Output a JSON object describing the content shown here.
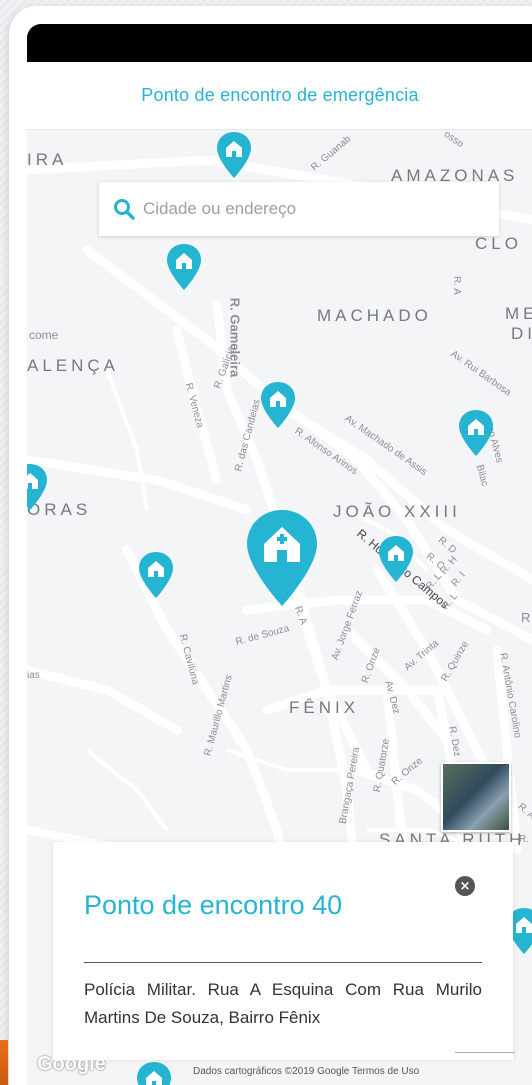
{
  "header": {
    "title": "Ponto de encontro de emergência"
  },
  "search": {
    "placeholder": "Cidade ou endereço",
    "icon": "search-icon"
  },
  "map": {
    "districts": [
      "IRA",
      "AMAZONAS",
      "CLO",
      "MACHADO",
      "ME",
      "DI",
      "ALENÇA",
      "ORAS",
      "JOÃO XXIII",
      "FÊNIX",
      "SANTA RUTH"
    ],
    "streets": [
      "R. Guanab",
      "osso",
      "R. A",
      "come",
      "Av. Rui Barbosa",
      "R. Gameleira",
      "R. Galícia",
      "R. Veneza",
      "R. das Candeias",
      "Av. Machado de Assis",
      "R. Afonso Arinos",
      "ro Alves",
      "Bilac",
      "R. Humberto Campos",
      "R. D",
      "R. C",
      "R. H",
      "R. L",
      "R. I",
      "R. L",
      "R. Cavilúna",
      "R. de Souza",
      "Av. Jorge Ferraz",
      "R. A",
      "R. Maurillo Martins",
      "R. Onze",
      "Av. Trinta",
      "R. Quinze",
      "R. Antônio Carolino",
      "Av. Dez",
      "R. Dez",
      "R. Onze",
      "R. Quatorze",
      "Brangaça Pereira",
      "ias",
      "R",
      "R. A",
      "R."
    ],
    "accent_color": "#26b4d3",
    "pin_icon": "house-pin-icon"
  },
  "map_controls": {
    "satellite": "satellite-view-thumbnail"
  },
  "footer": {
    "logo": "Google",
    "attribution": "Dados cartográficos ©2019 Google     Termos de Uso"
  },
  "info_card": {
    "title": "Ponto de encontro 40",
    "close_icon": "close-icon",
    "description": "Polícia Militar. Rua A Esquina Com Rua Murilo Martins De Souza, Bairro Fênix"
  }
}
